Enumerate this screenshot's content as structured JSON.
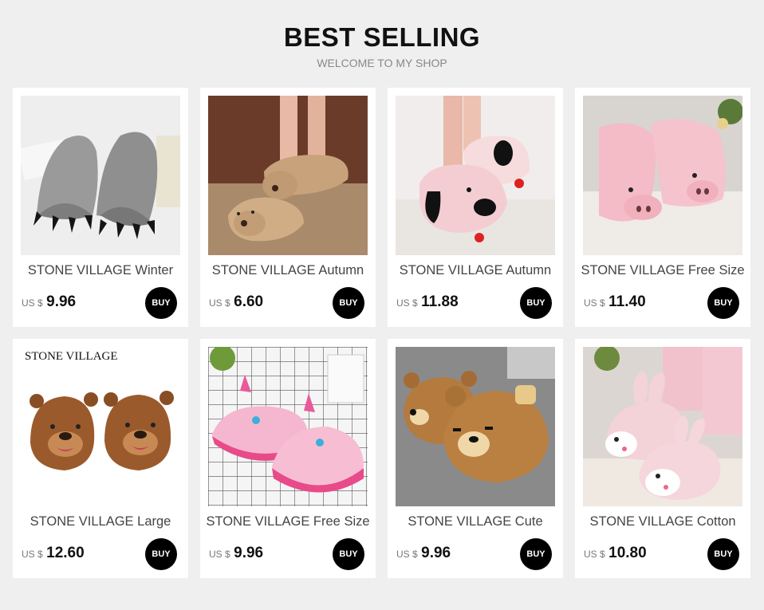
{
  "header": {
    "title": "BEST SELLING",
    "subtitle": "WELCOME TO MY SHOP"
  },
  "products": [
    {
      "name": "STONE VILLAGE Winter",
      "currency": "US $",
      "price": "9.96",
      "buy_label": "BUY",
      "image_icon": "gray-claw-slippers-image"
    },
    {
      "name": "STONE VILLAGE Autumn",
      "currency": "US $",
      "price": "6.60",
      "buy_label": "BUY",
      "image_icon": "bear-slippers-image"
    },
    {
      "name": "STONE VILLAGE Autumn",
      "currency": "US $",
      "price": "11.88",
      "buy_label": "BUY",
      "image_icon": "pink-dog-slippers-image"
    },
    {
      "name": "STONE VILLAGE Free Size",
      "currency": "US $",
      "price": "11.40",
      "buy_label": "BUY",
      "image_icon": "pink-pig-slippers-image"
    },
    {
      "name": "STONE VILLAGE Large",
      "currency": "US $",
      "price": "12.60",
      "buy_label": "BUY",
      "image_icon": "brown-bear-slippers-image",
      "image_caption": "STONE VILLAGE"
    },
    {
      "name": "STONE VILLAGE Free Size",
      "currency": "US $",
      "price": "9.96",
      "buy_label": "BUY",
      "image_icon": "pink-unicorn-slippers-image"
    },
    {
      "name": "STONE VILLAGE Cute",
      "currency": "US $",
      "price": "9.96",
      "buy_label": "BUY",
      "image_icon": "rilakkuma-bear-slippers-image"
    },
    {
      "name": "STONE VILLAGE Cotton",
      "currency": "US $",
      "price": "10.80",
      "buy_label": "BUY",
      "image_icon": "pink-rabbit-slippers-image"
    }
  ]
}
